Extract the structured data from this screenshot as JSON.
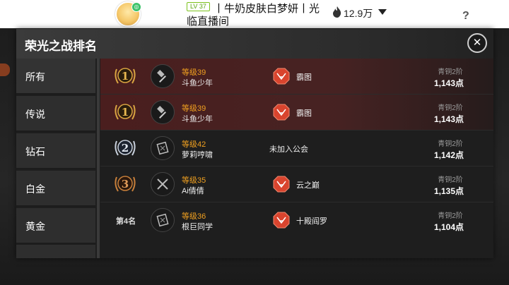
{
  "stream": {
    "level": "LV 37",
    "title_line1": "丨牛奶皮肤白梦妍丨光",
    "title_line2": "临直播间",
    "viewers": "12.9万",
    "help": "?"
  },
  "panel": {
    "title": "荣光之战排名",
    "close": "✕"
  },
  "tabs": [
    "所有",
    "传说",
    "钻石",
    "白金",
    "黄金"
  ],
  "rows": [
    {
      "rank": "1",
      "level": "等级39",
      "name": "斗鱼少年",
      "guild": "霸图",
      "tier": "青铜2阶",
      "points": "1,143点",
      "class_icon": "hammer-icon",
      "highlight": true
    },
    {
      "rank": "1",
      "level": "等级39",
      "name": "斗鱼少年",
      "guild": "霸图",
      "tier": "青铜2阶",
      "points": "1,143点",
      "class_icon": "hammer-icon",
      "highlight": true
    },
    {
      "rank": "2",
      "level": "等级42",
      "name": "萝莉哼啸",
      "guild": "未加入公会",
      "tier": "青铜2阶",
      "points": "1,142点",
      "class_icon": "book-icon",
      "highlight": false
    },
    {
      "rank": "3",
      "level": "等级35",
      "name": "Ai倩倩",
      "guild": "云之巅",
      "tier": "青铜2阶",
      "points": "1,135点",
      "class_icon": "crossed-swords-icon",
      "highlight": false
    },
    {
      "rank": "第4名",
      "level": "等级36",
      "name": "根巨同学",
      "guild": "十殿阎罗",
      "tier": "青铜2阶",
      "points": "1,104点",
      "class_icon": "book-icon",
      "highlight": false
    }
  ],
  "colors": {
    "gold": "#d9a441",
    "silver": "#c8d0dc",
    "bronze": "#c77f3a",
    "level_text": "#f0a020",
    "guild_badge": "#d9442e"
  }
}
